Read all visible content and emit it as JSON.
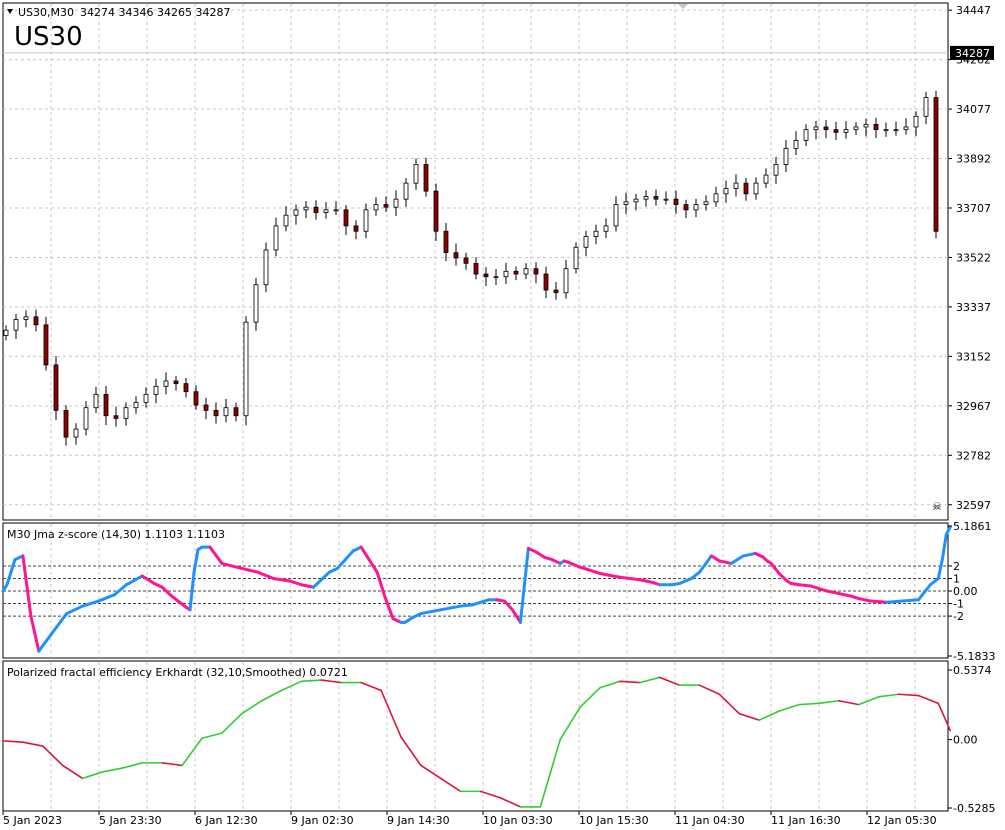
{
  "header": {
    "symbol_line": "US30,M30",
    "ohlc": "34274 34346 34265 34287",
    "big_symbol": "US30",
    "collapse_icon": "triangle-down-icon"
  },
  "colors": {
    "bull": "#ffffff",
    "bear": "#8b0000",
    "wick": "#000000",
    "grid": "#c8c8c8",
    "z_up": "#1e90ff",
    "z_down": "#ff1493",
    "pfe_up": "#32cd32",
    "pfe_down": "#dc143c"
  },
  "chart_data": [
    {
      "type": "candlestick",
      "title": "US30,M30",
      "y_ticks": [
        "34447",
        "34262",
        "34077",
        "33892",
        "33707",
        "33522",
        "33337",
        "33152",
        "32967",
        "32782",
        "32597"
      ],
      "ylim": [
        32540,
        34470
      ],
      "current_price": "34287",
      "grid": true,
      "close_series": [
        33250,
        33290,
        33300,
        33270,
        33120,
        32950,
        32850,
        32880,
        32960,
        33010,
        32930,
        32920,
        32960,
        32980,
        33010,
        33040,
        33060,
        33050,
        33020,
        32970,
        32950,
        32930,
        32960,
        32930,
        33280,
        33420,
        33550,
        33640,
        33680,
        33700,
        33710,
        33690,
        33700,
        33700,
        33640,
        33620,
        33700,
        33720,
        33710,
        33740,
        33800,
        33870,
        33770,
        33620,
        33540,
        33520,
        33500,
        33460,
        33450,
        33450,
        33470,
        33460,
        33480,
        33460,
        33400,
        33390,
        33480,
        33560,
        33600,
        33620,
        33640,
        33720,
        33730,
        33740,
        33750,
        33740,
        33740,
        33720,
        33700,
        33720,
        33730,
        33760,
        33780,
        33800,
        33760,
        33800,
        33830,
        33870,
        33930,
        33960,
        34000,
        34010,
        34000,
        33990,
        34000,
        34010,
        34020,
        34000,
        34000,
        34000,
        34010,
        34050,
        34120,
        33620
      ]
    },
    {
      "type": "line",
      "title": "M30 Jma z-score (14,30) 1.1103 1.1103",
      "y_ticks": [
        "5.1861",
        "2",
        "1",
        "0.00",
        "-1",
        "-2",
        "-5.1833"
      ],
      "levels": [
        2,
        1,
        0,
        -1,
        -2
      ],
      "ylim": [
        -5.1833,
        5.1861
      ],
      "x": [
        0,
        1,
        3,
        5,
        7,
        9,
        12,
        16,
        20,
        24,
        28,
        31,
        35,
        38,
        40,
        42,
        44,
        46,
        47,
        48,
        49,
        50,
        52,
        55,
        60,
        64,
        68,
        72,
        75,
        78,
        82,
        84,
        86,
        88,
        90,
        92,
        94,
        96,
        98,
        100,
        101,
        102,
        103,
        105,
        110,
        115,
        118,
        120,
        122,
        124,
        126,
        128,
        130,
        132,
        134,
        136,
        138,
        140,
        141,
        142,
        145,
        150,
        155,
        160,
        163,
        165,
        168,
        170,
        173,
        175,
        178,
        180,
        183,
        186,
        189,
        191,
        192,
        193,
        194,
        195,
        196,
        197,
        198,
        200,
        203,
        205,
        207,
        210,
        213,
        215,
        218,
        222,
        226,
        230,
        233,
        235,
        236,
        237,
        238
      ],
      "values": [
        0,
        0.5,
        2.5,
        2.8,
        -2,
        -4.8,
        -3.5,
        -1.8,
        -1.2,
        -0.8,
        -0.3,
        0.5,
        1.2,
        0.6,
        0.3,
        -0.3,
        -0.8,
        -1.3,
        -1.5,
        1.5,
        3.3,
        3.5,
        3.5,
        2.2,
        1.8,
        1.5,
        1,
        0.8,
        0.5,
        0.3,
        1.5,
        1.8,
        2.5,
        3.2,
        3.5,
        2.5,
        1.5,
        -0.5,
        -2.2,
        -2.5,
        -2.5,
        -2.3,
        -2.1,
        -1.8,
        -1.5,
        -1.2,
        -1.1,
        -0.9,
        -0.7,
        -0.7,
        -0.8,
        -1.5,
        -2.5,
        3.4,
        3.1,
        2.7,
        2.5,
        2.2,
        2.4,
        2.3,
        1.9,
        1.4,
        1.1,
        0.9,
        0.7,
        0.5,
        0.5,
        0.6,
        1.0,
        1.5,
        2.8,
        2.4,
        2.2,
        2.8,
        3.0,
        2.7,
        2.4,
        2.2,
        1.8,
        1.4,
        1.1,
        0.8,
        0.6,
        0.5,
        0.4,
        0.2,
        0.0,
        -0.2,
        -0.4,
        -0.6,
        -0.8,
        -0.9,
        -0.8,
        -0.7,
        0.5,
        1.0,
        2.5,
        4.5,
        5.1
      ]
    },
    {
      "type": "line",
      "title": "Polarized fractal efficiency Erkhardt (32,10,Smoothed) 0.0721",
      "y_ticks": [
        "0.5374",
        "0.00",
        "-0.5285"
      ],
      "ylim": [
        -0.5285,
        0.5374
      ],
      "x": [
        0,
        5,
        10,
        15,
        20,
        25,
        30,
        35,
        40,
        45,
        50,
        55,
        60,
        65,
        70,
        75,
        80,
        85,
        90,
        95,
        100,
        105,
        110,
        115,
        120,
        125,
        130,
        135,
        140,
        145,
        150,
        155,
        160,
        165,
        170,
        175,
        180,
        185,
        190,
        195,
        200,
        205,
        210,
        215,
        220,
        225,
        230,
        235,
        238
      ],
      "values": [
        -0.01,
        -0.02,
        -0.05,
        -0.2,
        -0.3,
        -0.25,
        -0.22,
        -0.18,
        -0.18,
        -0.2,
        0.01,
        0.05,
        0.2,
        0.3,
        0.38,
        0.45,
        0.46,
        0.44,
        0.44,
        0.38,
        0.02,
        -0.2,
        -0.3,
        -0.4,
        -0.4,
        -0.45,
        -0.52,
        -0.52,
        0.0,
        0.25,
        0.4,
        0.45,
        0.44,
        0.48,
        0.42,
        0.42,
        0.35,
        0.2,
        0.15,
        0.22,
        0.27,
        0.28,
        0.3,
        0.27,
        0.33,
        0.35,
        0.34,
        0.28,
        0.07
      ],
      "ylabel": ""
    }
  ],
  "time_axis": [
    "5 Jan 2023",
    "5 Jan 23:30",
    "6 Jan 12:30",
    "9 Jan 02:30",
    "9 Jan 14:30",
    "10 Jan 03:30",
    "10 Jan 15:30",
    "11 Jan 04:30",
    "11 Jan 16:30",
    "12 Jan 05:30"
  ]
}
